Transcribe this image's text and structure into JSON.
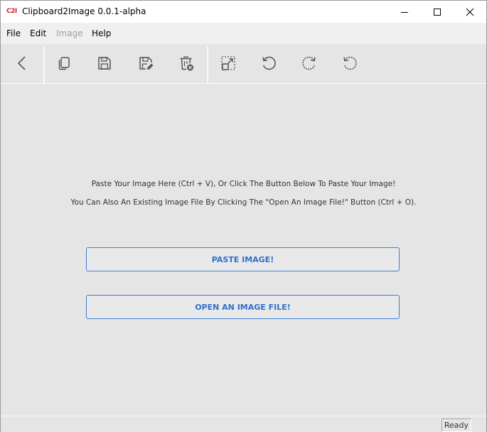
{
  "window": {
    "logo": "C2I",
    "title": "Clipboard2Image 0.0.1-alpha"
  },
  "menu": {
    "items": [
      {
        "label": "File",
        "enabled": true
      },
      {
        "label": "Edit",
        "enabled": true
      },
      {
        "label": "Image",
        "enabled": false
      },
      {
        "label": "Help",
        "enabled": true
      }
    ]
  },
  "toolbar": {
    "icons": [
      "back-icon",
      "copy-icon",
      "save-icon",
      "save-as-icon",
      "delete-icon",
      "resize-icon",
      "rotate-left-icon",
      "rotate-right-icon",
      "reset-icon"
    ]
  },
  "main": {
    "line1": "Paste Your Image Here (Ctrl + V), Or Click The Button Below To Paste Your Image!",
    "line2": "You Can Also An Existing Image File By Clicking The \"Open An Image File!\" Button (Ctrl + O).",
    "paste_button": "PASTE IMAGE!",
    "open_button": "OPEN AN IMAGE FILE!"
  },
  "status": {
    "text": "Ready"
  },
  "colors": {
    "accent": "#2f6fce",
    "logo": "#cf2027",
    "background": "#e5e5e5"
  }
}
